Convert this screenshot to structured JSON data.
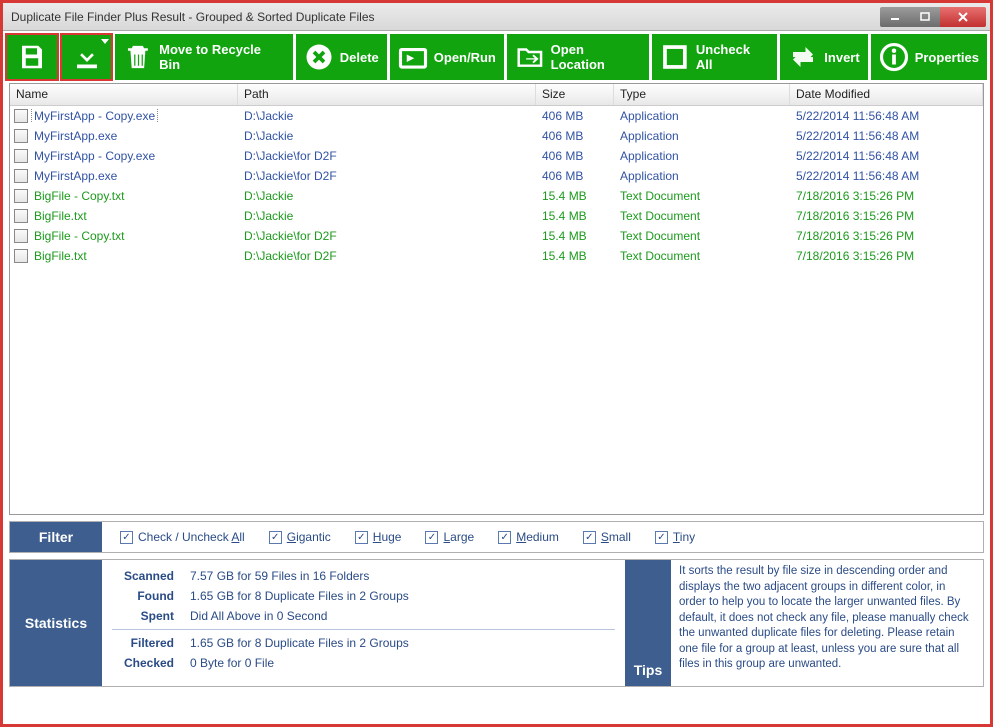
{
  "window": {
    "title": "Duplicate File Finder Plus Result - Grouped & Sorted Duplicate Files"
  },
  "toolbar": {
    "recycle": "Move to Recycle Bin",
    "delete": "Delete",
    "open": "Open/Run",
    "location": "Open Location",
    "uncheck": "Uncheck All",
    "invert": "Invert",
    "properties": "Properties"
  },
  "columns": {
    "name": "Name",
    "path": "Path",
    "size": "Size",
    "type": "Type",
    "date": "Date Modified"
  },
  "rows": [
    {
      "group": 0,
      "name": "MyFirstApp - Copy.exe",
      "path": "D:\\Jackie",
      "size": "406 MB",
      "type": "Application",
      "date": "5/22/2014 11:56:48 AM"
    },
    {
      "group": 0,
      "name": "MyFirstApp.exe",
      "path": "D:\\Jackie",
      "size": "406 MB",
      "type": "Application",
      "date": "5/22/2014 11:56:48 AM"
    },
    {
      "group": 0,
      "name": "MyFirstApp - Copy.exe",
      "path": "D:\\Jackie\\for D2F",
      "size": "406 MB",
      "type": "Application",
      "date": "5/22/2014 11:56:48 AM"
    },
    {
      "group": 0,
      "name": "MyFirstApp.exe",
      "path": "D:\\Jackie\\for D2F",
      "size": "406 MB",
      "type": "Application",
      "date": "5/22/2014 11:56:48 AM"
    },
    {
      "group": 1,
      "name": "BigFile - Copy.txt",
      "path": "D:\\Jackie",
      "size": "15.4 MB",
      "type": "Text Document",
      "date": "7/18/2016 3:15:26 PM"
    },
    {
      "group": 1,
      "name": "BigFile.txt",
      "path": "D:\\Jackie",
      "size": "15.4 MB",
      "type": "Text Document",
      "date": "7/18/2016 3:15:26 PM"
    },
    {
      "group": 1,
      "name": "BigFile - Copy.txt",
      "path": "D:\\Jackie\\for D2F",
      "size": "15.4 MB",
      "type": "Text Document",
      "date": "7/18/2016 3:15:26 PM"
    },
    {
      "group": 1,
      "name": "BigFile.txt",
      "path": "D:\\Jackie\\for D2F",
      "size": "15.4 MB",
      "type": "Text Document",
      "date": "7/18/2016 3:15:26 PM"
    }
  ],
  "filter": {
    "label": "Filter",
    "checkall_pre": "Check / Uncheck ",
    "checkall_u": "A",
    "checkall_post": "ll",
    "gigantic_u": "G",
    "gigantic_post": "igantic",
    "huge_u": "H",
    "huge_post": "uge",
    "large_u": "L",
    "large_post": "arge",
    "medium_u": "M",
    "medium_post": "edium",
    "small_u": "S",
    "small_post": "mall",
    "tiny_u": "T",
    "tiny_post": "iny"
  },
  "stats": {
    "label": "Statistics",
    "scanned_k": "Scanned",
    "scanned_v": "7.57 GB for 59 Files in 16 Folders",
    "found_k": "Found",
    "found_v": "1.65 GB for 8 Duplicate Files in 2 Groups",
    "spent_k": "Spent",
    "spent_v": "Did All Above in 0 Second",
    "filtered_k": "Filtered",
    "filtered_v": "1.65 GB for 8 Duplicate Files in 2 Groups",
    "checked_k": "Checked",
    "checked_v": "0 Byte for 0 File"
  },
  "tips": {
    "label": "Tips",
    "text": "It sorts the result by file size in descending order and displays the two adjacent groups in different color, in order to help you to locate the larger unwanted files. By default, it does not check any file, please manually check the unwanted duplicate files for deleting. Please retain one file for a group at least, unless you are sure that all files in this group are unwanted."
  }
}
